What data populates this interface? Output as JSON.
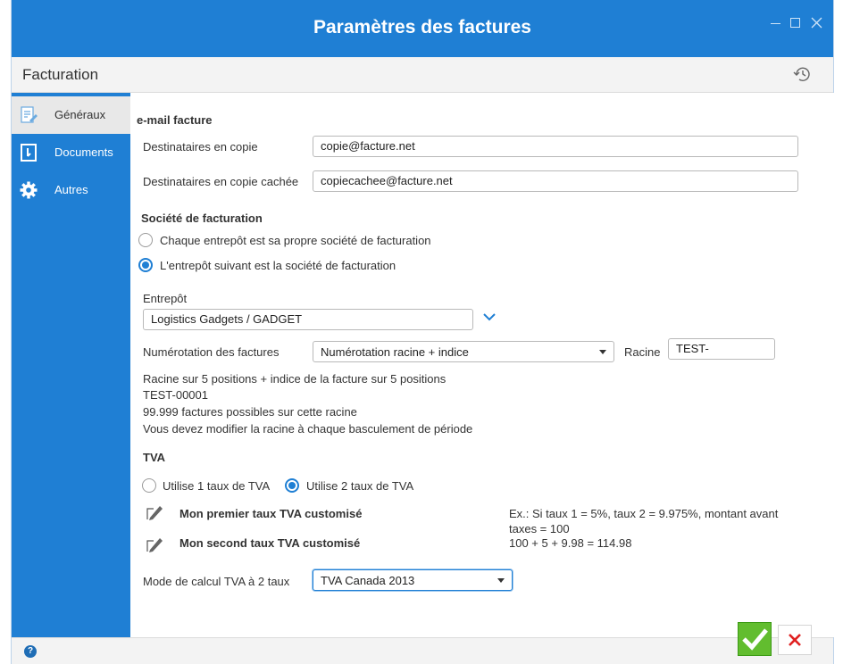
{
  "window": {
    "title": "Paramètres des factures"
  },
  "header": {
    "section": "Facturation"
  },
  "sidebar": {
    "items": [
      {
        "label": "Généraux",
        "icon": "document-edit-icon",
        "active": true
      },
      {
        "label": "Documents",
        "icon": "document-icon",
        "active": false
      },
      {
        "label": "Autres",
        "icon": "gear-icon",
        "active": false
      }
    ]
  },
  "email": {
    "title": "e-mail facture",
    "cc_label": "Destinataires en copie",
    "cc_value": "copie@facture.net",
    "bcc_label": "Destinataires en copie cachée",
    "bcc_value": "copiecachee@facture.net"
  },
  "company": {
    "title": "Société de facturation",
    "option1": "Chaque entrepôt est sa propre société de facturation",
    "option2": "L'entrepôt suivant est la société de facturation",
    "selected": 2,
    "warehouse_label": "Entrepôt",
    "warehouse_value": "Logistics Gadgets / GADGET"
  },
  "numbering": {
    "label": "Numérotation des factures",
    "value": "Numérotation racine + indice",
    "root_label": "Racine",
    "root_value": "TEST-",
    "info": [
      "Racine sur 5 positions + indice de la facture sur 5 positions",
      "TEST-00001",
      "99.999 factures possibles sur cette racine",
      "Vous devez modifier la racine à chaque basculement de période"
    ]
  },
  "tva": {
    "title": "TVA",
    "option1": "Utilise 1 taux de TVA",
    "option2": "Utilise 2 taux de TVA",
    "selected": 2,
    "rate1": "Mon premier taux TVA customisé",
    "rate2": "Mon second taux TVA customisé",
    "example_line1": "Ex.: Si taux 1 = 5%, taux 2 = 9.975%, montant avant",
    "example_line2": "taxes = 100",
    "example_line3": "100 + 5 + 9.98 = 114.98",
    "mode_label": "Mode de calcul TVA à 2 taux",
    "mode_value": "TVA Canada 2013"
  },
  "footer": {
    "help_glyph": "?"
  },
  "colors": {
    "accent": "#1f7fd4",
    "ok": "#62bd2f",
    "cancel": "#e02020"
  }
}
